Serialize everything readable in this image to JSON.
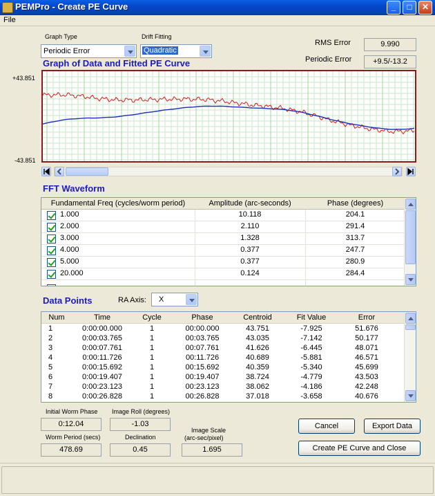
{
  "window": {
    "title": "PEMPro - Create PE Curve",
    "min": "_",
    "max": "□",
    "close": "✕"
  },
  "menu": {
    "file": "File"
  },
  "graph_type": {
    "label": "Graph Type",
    "value": "Periodic Error"
  },
  "drift_fitting": {
    "label": "Drift Fitting",
    "value": "Quadratic"
  },
  "rms_error": {
    "label": "RMS Error",
    "value": "9.990"
  },
  "periodic_error": {
    "label": "Periodic Error",
    "value": "+9.5/-13.2"
  },
  "graph": {
    "title": "Graph of Data and Fitted PE Curve",
    "ymax_label": "+43.851",
    "ymin_label": "-43.851",
    "colors": {
      "data": "#d21f1f",
      "fit": "#1f2fb4",
      "grid_h": "#c8e6c8",
      "grid_v": "#9fd89f",
      "border": "#8b1a1a"
    }
  },
  "fft": {
    "title": "FFT Waveform",
    "columns": [
      "Fundamental Freq (cycles/worm period)",
      "Amplitude (arc-seconds)",
      "Phase (degrees)"
    ],
    "rows": [
      {
        "freq": "1.000",
        "amp": "10.118",
        "phase": "204.1"
      },
      {
        "freq": "2.000",
        "amp": "2.110",
        "phase": "291.4"
      },
      {
        "freq": "3.000",
        "amp": "1.328",
        "phase": "313.7"
      },
      {
        "freq": "4.000",
        "amp": "0.377",
        "phase": "247.7"
      },
      {
        "freq": "5.000",
        "amp": "0.377",
        "phase": "280.9"
      },
      {
        "freq": "20.000",
        "amp": "0.124",
        "phase": "284.4"
      }
    ]
  },
  "data_points": {
    "title": "Data Points",
    "ra_axis_label": "RA Axis:",
    "ra_axis_value": "X",
    "columns": [
      "Num",
      "Time",
      "Cycle",
      "Phase",
      "Centroid",
      "Fit Value",
      "Error"
    ],
    "rows": [
      [
        "1",
        "0:00:00.000",
        "1",
        "00:00.000",
        "43.751",
        "-7.925",
        "51.676"
      ],
      [
        "2",
        "0:00:03.765",
        "1",
        "00:03.765",
        "43.035",
        "-7.142",
        "50.177"
      ],
      [
        "3",
        "0:00:07.761",
        "1",
        "00:07.761",
        "41.626",
        "-6.445",
        "48.071"
      ],
      [
        "4",
        "0:00:11.726",
        "1",
        "00:11.726",
        "40.689",
        "-5.881",
        "46.571"
      ],
      [
        "5",
        "0:00:15.692",
        "1",
        "00:15.692",
        "40.359",
        "-5.340",
        "45.699"
      ],
      [
        "6",
        "0:00:19.407",
        "1",
        "00:19.407",
        "38.724",
        "-4.779",
        "43.503"
      ],
      [
        "7",
        "0:00:23.123",
        "1",
        "00:23.123",
        "38.062",
        "-4.186",
        "42.248"
      ],
      [
        "8",
        "0:00:26.828",
        "1",
        "00:26.828",
        "37.018",
        "-3.658",
        "40.676"
      ]
    ]
  },
  "fields": {
    "initial_worm_phase": {
      "label": "Initial Worm Phase",
      "value": "0:12.04"
    },
    "image_roll": {
      "label": "Image Roll (degrees)",
      "value": "-1.03"
    },
    "worm_period": {
      "label": "Worm Period (secs)",
      "value": "478.69"
    },
    "declination": {
      "label": "Declination",
      "value": "0.45"
    },
    "image_scale": {
      "label_line1": "Image Scale",
      "label_line2": "(arc-sec/pixel)",
      "value": "1.695"
    }
  },
  "buttons": {
    "cancel": "Cancel",
    "export": "Export Data",
    "create": "Create PE Curve and Close"
  }
}
